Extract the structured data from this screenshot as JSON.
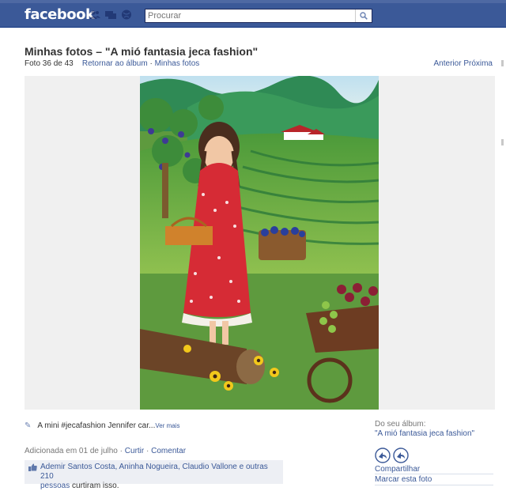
{
  "topbar": {
    "logo": "facebook",
    "search_placeholder": "Procurar",
    "icons": [
      "friend-requests-icon",
      "messages-icon",
      "notifications-icon"
    ]
  },
  "page": {
    "title": "Minhas fotos – \"A mió fantasia jeca fashion\"",
    "photo_counter": "Foto 36 de 43",
    "back_to_album": "Retornar ao álbum",
    "separator": "·",
    "my_photos": "Minhas fotos",
    "prev": "Anterior",
    "next": "Próxima"
  },
  "caption": {
    "text": "A mini #jecafashion Jennifer car...",
    "see_more": "Ver mais"
  },
  "meta": {
    "added": "Adicionada em 01 de julho",
    "like": "Curtir",
    "comment": "Comentar"
  },
  "likes": {
    "names_text": "Ademir Santos Costa, Aninha Nogueira, Claudio Vallone e outras 210",
    "people": "pessoas",
    "suffix": "curtiram isso."
  },
  "sidebar": {
    "from_album_label": "Do seu álbum:",
    "album_name": "\"A mió fantasia jeca fashion\"",
    "share": "Compartilhar",
    "tag_photo": "Marcar esta foto"
  },
  "colors": {
    "brand_blue": "#3b5998",
    "link": "#3b5998",
    "likes_bg": "#edeff4"
  }
}
